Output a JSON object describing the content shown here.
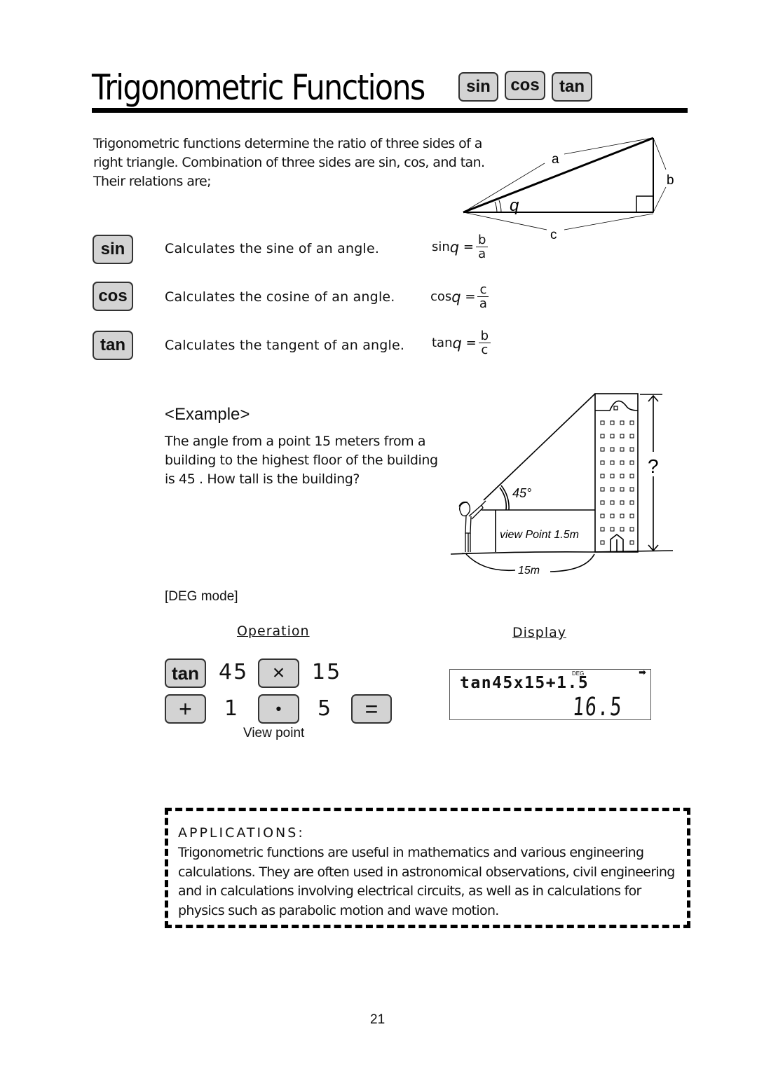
{
  "header": {
    "title": "Trigonometric Functions",
    "keys": [
      "sin",
      "cos",
      "tan"
    ]
  },
  "intro": "Trigonometric functions determine the ratio of three sides of a right triangle. Combination of three sides are sin, cos, and tan. Their relations are;",
  "triangle": {
    "labels": {
      "hypotenuse": "a",
      "opposite": "b",
      "adjacent": "c",
      "angle": "q"
    }
  },
  "functions": [
    {
      "key": "sin",
      "description": "Calculates the sine of an angle.",
      "formula_lhs": "sin",
      "angle": "q",
      "numerator": "b",
      "denominator": "a"
    },
    {
      "key": "cos",
      "description": "Calculates the cosine of an angle.",
      "formula_lhs": "cos",
      "angle": "q",
      "numerator": "c",
      "denominator": "a"
    },
    {
      "key": "tan",
      "description": "Calculates the tangent of an angle.",
      "formula_lhs": "tan",
      "angle": "q",
      "numerator": "b",
      "denominator": "c"
    }
  ],
  "example": {
    "heading": "<Example>",
    "text": "The angle from a point 15 meters from a building to the highest floor of the building is 45  . How tall is the building?",
    "figure": {
      "angle_label": "45°",
      "view_point_label": "view Point 1.5m",
      "distance_label": "15m",
      "height_label": "?"
    }
  },
  "mode": "[DEG mode]",
  "operation": {
    "heading": "Operation",
    "row1": [
      {
        "type": "key",
        "label": "tan"
      },
      {
        "type": "num",
        "label": "45"
      },
      {
        "type": "key",
        "label": "×"
      },
      {
        "type": "num",
        "label": "15"
      }
    ],
    "row2": [
      {
        "type": "key",
        "label": "+"
      },
      {
        "type": "num",
        "label": "1"
      },
      {
        "type": "key",
        "label": "•"
      },
      {
        "type": "num",
        "label": "5"
      },
      {
        "type": "key",
        "label": "="
      }
    ],
    "note": "View point"
  },
  "display": {
    "heading": "Display",
    "indicator": "DEG",
    "arrow": "➡",
    "expression": "tan45x15+1.5",
    "result": "16.5"
  },
  "applications": {
    "heading": "APPLICATIONS:",
    "text": "Trigonometric functions are useful in mathematics and various engineering calculations. They are often used in astronomical observations, civil engineering and in calculations involving electrical circuits, as well as in calculations for physics such as parabolic motion and wave motion."
  },
  "page_number": "21"
}
